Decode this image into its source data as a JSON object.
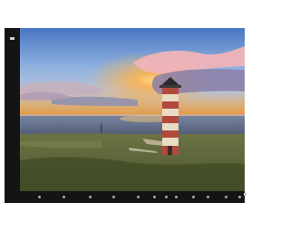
{
  "viewer": {
    "image": {
      "subject": "lighthouse-at-sunset",
      "colors": {
        "sky_top": "#4f78c0",
        "sky_mid": "#8eb0de",
        "sunset_glow": "#ffb24a",
        "sea": "#6e7f9f",
        "grass": "#5f6a3c",
        "lighthouse_red": "#b14a3d",
        "lighthouse_cream": "#e8dcc4"
      }
    },
    "toolbar": {
      "buttons": [
        {
          "icon": "rotate-left-icon"
        },
        {
          "icon": "rotate-right-icon"
        },
        {
          "icon": "zoom-out-icon"
        },
        {
          "icon": "zoom-in-icon"
        },
        {
          "icon": "fit-icon"
        },
        {
          "icon": "fullscreen-icon"
        },
        {
          "icon": "info-icon"
        },
        {
          "icon": "edit-icon"
        },
        {
          "icon": "share-icon"
        },
        {
          "icon": "favorite-icon"
        },
        {
          "icon": "delete-icon"
        },
        {
          "icon": "more-icon"
        }
      ]
    },
    "left_rail_icon": "menu-icon"
  }
}
